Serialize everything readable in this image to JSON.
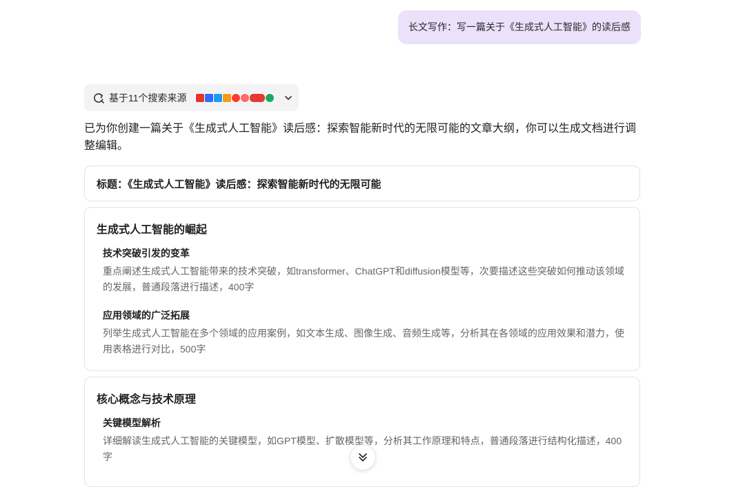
{
  "user_message": "长文写作：写一篇关于《生成式人工智能》的读后感",
  "sources": {
    "label": "基于11个搜索来源",
    "favicon_colors": [
      "#e8332a",
      "#2f6bff",
      "#1a9df0",
      "#f39c12",
      "#ff3b30",
      "#ff6b6b",
      "#e53935",
      "#1ea861"
    ]
  },
  "intro_text": "已为你创建一篇关于《生成式人工智能》读后感：探索智能新时代的无限可能的文章大纲，你可以生成文档进行调整编辑。",
  "outline": {
    "title": "标题：《生成式人工智能》读后感：探索智能新时代的无限可能",
    "sections": [
      {
        "heading": "生成式人工智能的崛起",
        "items": [
          {
            "title": "技术突破引发的变革",
            "desc": "重点阐述生成式人工智能带来的技术突破，如transformer、ChatGPT和diffusion模型等，次要描述这些突破如何推动该领域的发展，普通段落进行描述，400字"
          },
          {
            "title": "应用领域的广泛拓展",
            "desc": "列举生成式人工智能在多个领域的应用案例，如文本生成、图像生成、音频生成等，分析其在各领域的应用效果和潜力，使用表格进行对比，500字"
          }
        ]
      },
      {
        "heading": "核心概念与技术原理",
        "items": [
          {
            "title": "关键模型解析",
            "desc": "详细解读生成式人工智能的关键模型，如GPT模型、扩散模型等，分析其工作原理和特点，普通段落进行结构化描述，400字"
          }
        ]
      }
    ]
  },
  "icons": {
    "search": "search-refresh-icon",
    "chevron": "chevron-down-icon",
    "scroll": "double-chevron-down-icon"
  }
}
